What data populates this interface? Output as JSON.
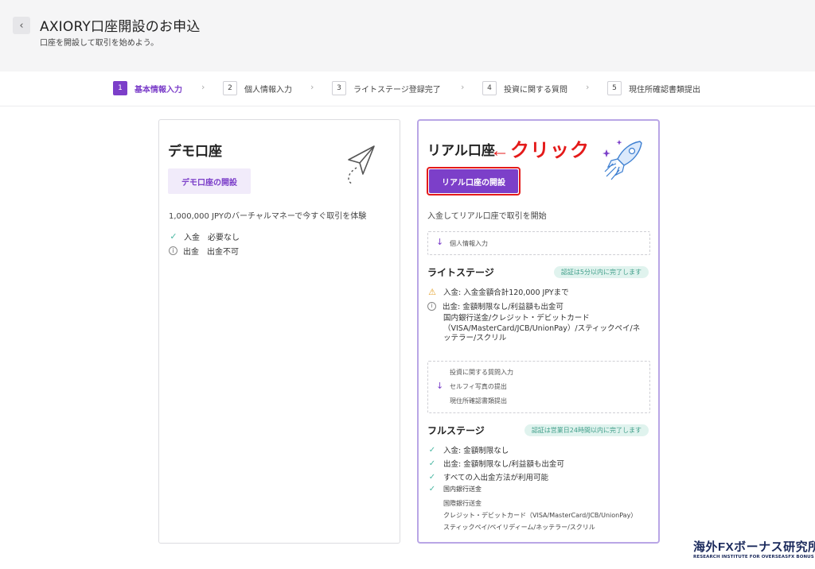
{
  "header": {
    "back_icon": "chevron-left-icon",
    "title": "AXIORY口座開設のお申込",
    "subtitle": "口座を開設して取引を始めよう。"
  },
  "stepper": {
    "steps": [
      {
        "num": "1",
        "label": "基本情報入力",
        "active": true
      },
      {
        "num": "2",
        "label": "個人情報入力",
        "active": false
      },
      {
        "num": "3",
        "label": "ライトステージ登録完了",
        "active": false
      },
      {
        "num": "4",
        "label": "投資に関する質問",
        "active": false
      },
      {
        "num": "5",
        "label": "現住所確認書類提出",
        "active": false
      }
    ],
    "separator": "›"
  },
  "demo": {
    "title": "デモ口座",
    "button": "デモ口座の開設",
    "description": "1,000,000 JPYのバーチャルマネーで今すぐ取引を体験",
    "features": [
      {
        "icon": "check-icon",
        "text": "入金　必要なし"
      },
      {
        "icon": "info-icon",
        "text": "出金　出金不可"
      }
    ],
    "illustration": "paper-plane-icon"
  },
  "real": {
    "title": "リアル口座",
    "annotation": "←クリック",
    "button": "リアル口座の開設",
    "description": "入金してリアル口座で取引を開始",
    "illustration": "rocket-icon",
    "step_box_1": "個人情報入力",
    "light_stage": {
      "title": "ライトステージ",
      "badge": "認証は5分以内に完了します",
      "deposit": "入金: 入金金額合計120,000 JPYまで",
      "withdraw": "出金: 金額制限なし/利益額も出金可",
      "methods_line1": "国内銀行送金/クレジット・デビットカード",
      "methods_line2": "（VISA/MasterCard/JCB/UnionPay）/スティックペイ/ネ",
      "methods_line3": "ッテラー/スクリル"
    },
    "step_box_2": [
      "投資に関する質問入力",
      "セルフィ写真の提出",
      "現住所確認書類提出"
    ],
    "full_stage": {
      "title": "フルステージ",
      "badge": "認証は営業日24時間以内に完了します",
      "deposit": "入金: 金額制限なし",
      "withdraw": "出金: 金額制限なし/利益額も出金可",
      "all_methods": "すべての入出金方法が利用可能",
      "method_list": [
        "国内銀行送金",
        "国際銀行送金",
        "クレジット・デビットカード（VISA/MasterCard/JCB/UnionPay）",
        "スティックペイ/ペイリディーム/ネッテラー/スクリル"
      ]
    }
  },
  "watermark": {
    "main": "海外FXボーナス研究所",
    "sub": "RESEARCH INSTITUTE FOR OVERSEASFX BONUS"
  },
  "colors": {
    "accent": "#7c3fc9",
    "annotation": "#e41a1a",
    "success": "#4bb8a3",
    "warning": "#e4a22c"
  }
}
